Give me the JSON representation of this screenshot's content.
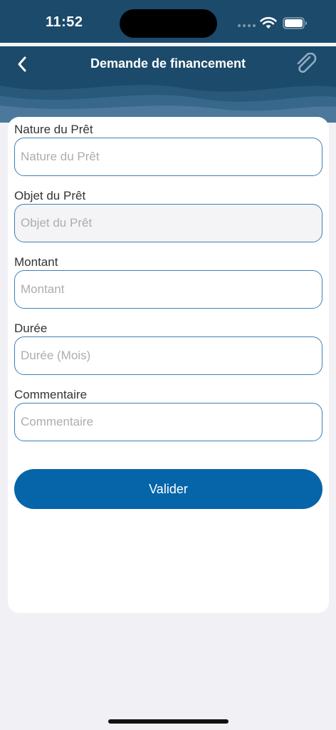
{
  "status_bar": {
    "time": "11:52",
    "icons": [
      "signal-icon",
      "wifi-icon",
      "battery-icon"
    ]
  },
  "nav": {
    "title": "Demande de financement",
    "back_icon": "chevron-left-icon",
    "attach_icon": "paperclip-icon"
  },
  "form": {
    "fields": [
      {
        "label": "Nature du Prêt",
        "placeholder": "Nature du Prêt",
        "value": ""
      },
      {
        "label": "Objet du Prêt",
        "placeholder": "Objet du Prêt",
        "value": ""
      },
      {
        "label": "Montant",
        "placeholder": "Montant",
        "value": ""
      },
      {
        "label": "Durée",
        "placeholder": "Durée (Mois)",
        "value": ""
      },
      {
        "label": "Commentaire",
        "placeholder": "Commentaire",
        "value": ""
      }
    ],
    "submit_label": "Valider"
  },
  "colors": {
    "header": "#1b4a6b",
    "accent": "#0565a8",
    "input_border": "#3d7fb8",
    "background": "#f1f0f5"
  }
}
